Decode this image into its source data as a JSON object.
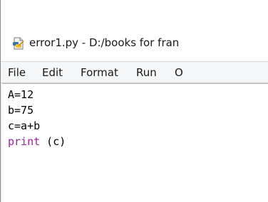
{
  "window": {
    "title": "error1.py - D:/books for fran"
  },
  "menubar": {
    "items": [
      "File",
      "Edit",
      "Format",
      "Run",
      "O"
    ]
  },
  "editor": {
    "lines": [
      {
        "text": "A=12"
      },
      {
        "text": "b=75"
      },
      {
        "text": "c=a+b"
      },
      {
        "keyword": "print",
        "rest": " (c)"
      }
    ]
  },
  "colors": {
    "keyword": "#a020a0",
    "text": "#000000",
    "background": "#ffffff",
    "menubar": "#f5f6f7"
  },
  "icons": {
    "title": "python-file-icon"
  }
}
